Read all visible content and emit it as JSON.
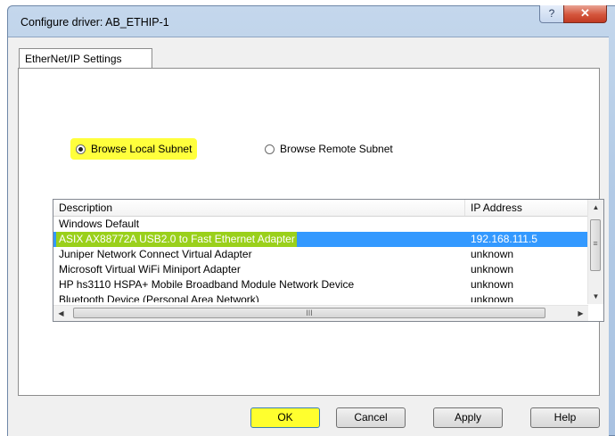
{
  "window": {
    "title": "Configure driver: AB_ETHIP-1",
    "help_glyph": "?",
    "close_glyph": "✕"
  },
  "tabs": [
    {
      "label": "EtherNet/IP Settings"
    }
  ],
  "radios": {
    "local_label": "Browse Local Subnet",
    "remote_label": "Browse Remote Subnet",
    "selected": "local"
  },
  "list": {
    "columns": {
      "description": "Description",
      "ip": "IP Address"
    },
    "rows": [
      {
        "description": "Windows Default",
        "ip": ""
      },
      {
        "description": "ASIX AX88772A USB2.0 to Fast Ethernet Adapter",
        "ip": "192.168.111.5"
      },
      {
        "description": "Juniper Network Connect Virtual Adapter",
        "ip": "unknown"
      },
      {
        "description": "Microsoft Virtual WiFi Miniport Adapter",
        "ip": "unknown"
      },
      {
        "description": "HP hs3110 HSPA+ Mobile Broadband Module Network Device",
        "ip": "unknown"
      },
      {
        "description": "Bluetooth Device (Personal Area Network)",
        "ip": "unknown"
      }
    ],
    "selected_row": 1
  },
  "buttons": {
    "ok": "OK",
    "cancel": "Cancel",
    "apply": "Apply",
    "help": "Help"
  },
  "colors": {
    "highlight": "#ffff3c",
    "selection": "#3399ff",
    "selected_text_bg": "#9ad01b"
  }
}
